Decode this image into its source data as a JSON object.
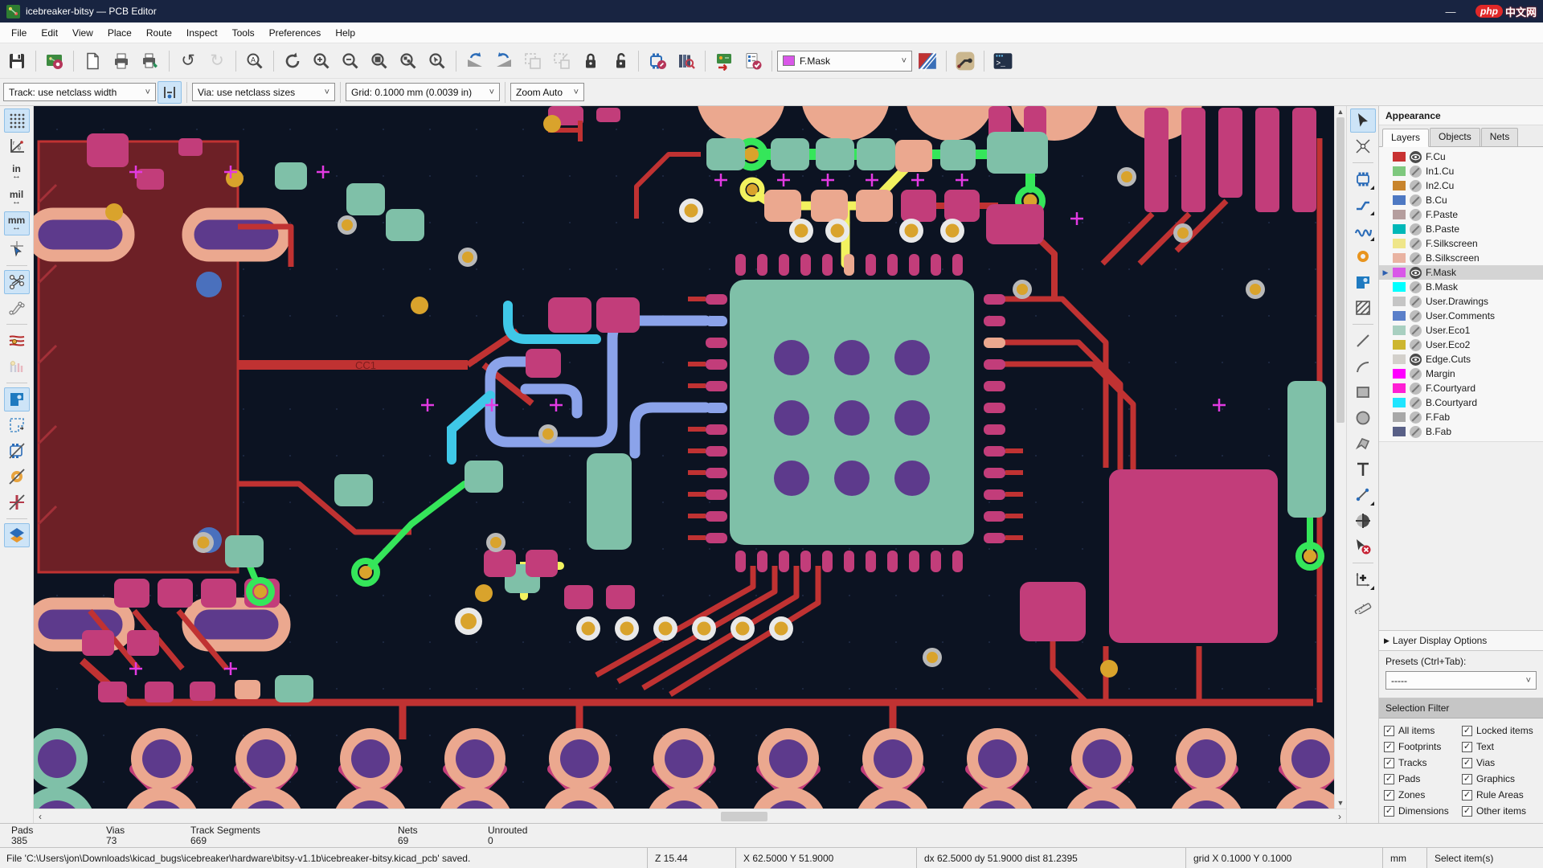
{
  "window": {
    "title": "icebreaker-bitsy — PCB Editor",
    "minimize": "—",
    "watermark": {
      "badge": "php",
      "text": "中文网"
    }
  },
  "menu": {
    "items": [
      "File",
      "Edit",
      "View",
      "Place",
      "Route",
      "Inspect",
      "Tools",
      "Preferences",
      "Help"
    ]
  },
  "toolbar": {
    "layer_select": {
      "value": "F.Mask",
      "swatch": "#d957e8"
    }
  },
  "controls": {
    "track": "Track: use netclass width",
    "via": "Via: use netclass sizes",
    "grid": "Grid: 0.1000 mm (0.0039 in)",
    "zoom": "Zoom Auto"
  },
  "left_toolbar": {
    "units": [
      "in",
      "mil",
      "mm"
    ]
  },
  "canvas": {
    "board_label": "CC1"
  },
  "appearance": {
    "title": "Appearance",
    "tabs": [
      "Layers",
      "Objects",
      "Nets"
    ],
    "active_tab": "Layers",
    "layers": [
      {
        "name": "F.Cu",
        "color": "#c83232",
        "visible": true,
        "selected": false
      },
      {
        "name": "In1.Cu",
        "color": "#7ec87e",
        "visible": false,
        "selected": false
      },
      {
        "name": "In2.Cu",
        "color": "#c8842c",
        "visible": false,
        "selected": false
      },
      {
        "name": "B.Cu",
        "color": "#4e79c3",
        "visible": false,
        "selected": false
      },
      {
        "name": "F.Paste",
        "color": "#b59e9e",
        "visible": false,
        "selected": false
      },
      {
        "name": "B.Paste",
        "color": "#00b8b8",
        "visible": false,
        "selected": false
      },
      {
        "name": "F.Silkscreen",
        "color": "#efe68a",
        "visible": false,
        "selected": false
      },
      {
        "name": "B.Silkscreen",
        "color": "#e9b3a2",
        "visible": false,
        "selected": false
      },
      {
        "name": "F.Mask",
        "color": "#d957e8",
        "visible": true,
        "selected": true
      },
      {
        "name": "B.Mask",
        "color": "#00ffff",
        "visible": false,
        "selected": false
      },
      {
        "name": "User.Drawings",
        "color": "#c5c5c5",
        "visible": false,
        "selected": false
      },
      {
        "name": "User.Comments",
        "color": "#5a7fc9",
        "visible": false,
        "selected": false
      },
      {
        "name": "User.Eco1",
        "color": "#a8cfc0",
        "visible": false,
        "selected": false
      },
      {
        "name": "User.Eco2",
        "color": "#cdb62f",
        "visible": false,
        "selected": false
      },
      {
        "name": "Edge.Cuts",
        "color": "#d3d0cb",
        "visible": true,
        "selected": false
      },
      {
        "name": "Margin",
        "color": "#ff00ff",
        "visible": false,
        "selected": false
      },
      {
        "name": "F.Courtyard",
        "color": "#ff1fd4",
        "visible": false,
        "selected": false
      },
      {
        "name": "B.Courtyard",
        "color": "#1fe5ff",
        "visible": false,
        "selected": false
      },
      {
        "name": "F.Fab",
        "color": "#a8a8a8",
        "visible": false,
        "selected": false
      },
      {
        "name": "B.Fab",
        "color": "#596087",
        "visible": false,
        "selected": false
      }
    ],
    "layer_display_options": "Layer Display Options",
    "presets_label": "Presets (Ctrl+Tab):",
    "presets_value": "-----"
  },
  "selection_filter": {
    "title": "Selection Filter",
    "items": [
      {
        "label": "All items",
        "checked": true
      },
      {
        "label": "Locked items",
        "checked": true
      },
      {
        "label": "Footprints",
        "checked": true
      },
      {
        "label": "Text",
        "checked": true
      },
      {
        "label": "Tracks",
        "checked": true
      },
      {
        "label": "Vias",
        "checked": true
      },
      {
        "label": "Pads",
        "checked": true
      },
      {
        "label": "Graphics",
        "checked": true
      },
      {
        "label": "Zones",
        "checked": true
      },
      {
        "label": "Rule Areas",
        "checked": true
      },
      {
        "label": "Dimensions",
        "checked": true
      },
      {
        "label": "Other items",
        "checked": true
      }
    ]
  },
  "status": {
    "cells": [
      {
        "label": "Pads",
        "value": "385"
      },
      {
        "label": "Vias",
        "value": "73"
      },
      {
        "label": "Track Segments",
        "value": "669"
      },
      {
        "label": "Nets",
        "value": "69"
      },
      {
        "label": "Unrouted",
        "value": "0"
      }
    ]
  },
  "message_bar": {
    "text": "File 'C:\\Users\\jon\\Downloads\\kicad_bugs\\icebreaker\\hardware\\bitsy-v1.1b\\icebreaker-bitsy.kicad_pcb' saved."
  },
  "info_cells": [
    "Z 15.44",
    "X 62.5000  Y 51.9000",
    "dx 62.5000  dy 51.9000  dist 81.2395",
    "grid X 0.1000  Y 0.1000",
    "mm",
    "Select item(s)"
  ]
}
